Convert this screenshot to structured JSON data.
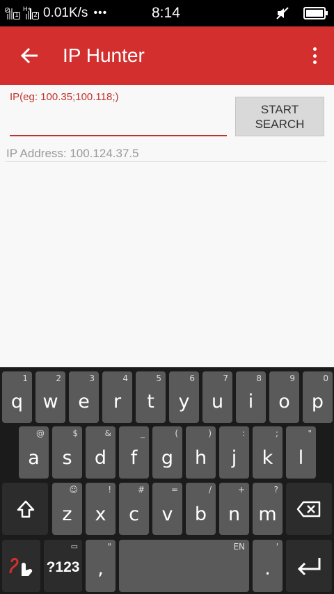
{
  "status_bar": {
    "network_rate": "0.01K/s",
    "more_indicator": "•••",
    "time": "8:14",
    "sim1_label": "1",
    "sim2_label": "2",
    "icons": [
      "signal-icon-sim1",
      "signal-icon-sim2",
      "mute-icon",
      "battery-icon"
    ]
  },
  "app_bar": {
    "title": "IP Hunter",
    "back_icon": "arrow-left-icon",
    "menu_icon": "more-vert-icon",
    "color": "#d32f2f"
  },
  "form": {
    "input_hint": "IP(eg: 100.35;100.118;)",
    "input_value": "",
    "start_button_label": "START\nSEARCH",
    "ip_address_text": "IP Address: 100.124.37.5"
  },
  "keyboard": {
    "row1": [
      {
        "main": "q",
        "sub": "1"
      },
      {
        "main": "w",
        "sub": "2"
      },
      {
        "main": "e",
        "sub": "3"
      },
      {
        "main": "r",
        "sub": "4"
      },
      {
        "main": "t",
        "sub": "5"
      },
      {
        "main": "y",
        "sub": "6"
      },
      {
        "main": "u",
        "sub": "7"
      },
      {
        "main": "i",
        "sub": "8"
      },
      {
        "main": "o",
        "sub": "9"
      },
      {
        "main": "p",
        "sub": "0"
      }
    ],
    "row2": [
      {
        "main": "a",
        "sub": "@"
      },
      {
        "main": "s",
        "sub": "$"
      },
      {
        "main": "d",
        "sub": "&"
      },
      {
        "main": "f",
        "sub": "_"
      },
      {
        "main": "g",
        "sub": "("
      },
      {
        "main": "h",
        "sub": ")"
      },
      {
        "main": "j",
        "sub": ":"
      },
      {
        "main": "k",
        "sub": ";"
      },
      {
        "main": "l",
        "sub": "\""
      }
    ],
    "row3": [
      {
        "main": "z",
        "sub": "☺"
      },
      {
        "main": "x",
        "sub": "!"
      },
      {
        "main": "c",
        "sub": "#"
      },
      {
        "main": "v",
        "sub": "="
      },
      {
        "main": "b",
        "sub": "/"
      },
      {
        "main": "n",
        "sub": "+"
      },
      {
        "main": "m",
        "sub": "?"
      }
    ],
    "shift_icon": "shift-icon",
    "backspace_icon": "backspace-icon",
    "swype_icon": "swype-icon",
    "symbols_label": "?123",
    "comma_label": ",",
    "comma_sub": "\"",
    "space_sub": "EN",
    "period_label": ".",
    "period_sub": "'",
    "enter_icon": "enter-icon"
  }
}
